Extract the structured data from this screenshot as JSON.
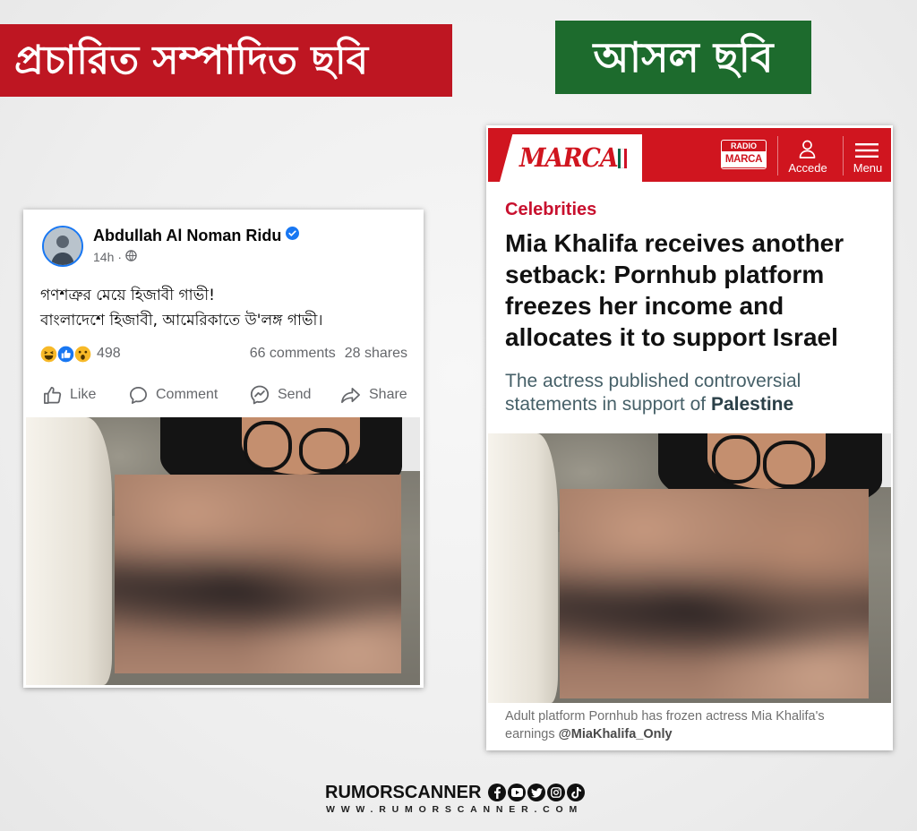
{
  "colors": {
    "edited_banner": "#be1622",
    "original_banner": "#1d6b2d",
    "marca_red": "#d0151f",
    "facebook_blue": "#1877f2",
    "category_red": "#c8102e",
    "background": "#efefef"
  },
  "banners": {
    "edited": {
      "label": "প্রচারিত সম্পাদিত ছবি"
    },
    "original": {
      "label": "আসল ছবি"
    }
  },
  "facebook_post": {
    "author": "Abdullah Al Noman Ridu",
    "verified_icon": "verified-badge-icon",
    "time": "14h",
    "time_separator": "·",
    "audience_icon": "globe-icon",
    "text_lines": [
      "গণশত্রুর মেয়ে হিজাবী গাভী!",
      "বাংলাদেশে হিজাবী, আমেরিকাতে উ'লঙ্গ গাভী।"
    ],
    "reaction_icons": [
      "haha-icon",
      "like-icon",
      "wow-icon"
    ],
    "reaction_count": "498",
    "comments": "66 comments",
    "shares": "28 shares",
    "actions": [
      {
        "label": "Like",
        "icon": "thumbs-up-icon"
      },
      {
        "label": "Comment",
        "icon": "comment-icon"
      },
      {
        "label": "Send",
        "icon": "messenger-icon"
      },
      {
        "label": "Share",
        "icon": "share-icon"
      }
    ]
  },
  "marca_article": {
    "logo": "MARCA",
    "logo_icon": "flag-icon",
    "radio_badge": {
      "top": "RADIO",
      "bottom": "MARCA"
    },
    "account_icon": "user-icon",
    "account_label": "Accede",
    "menu_icon": "hamburger-icon",
    "menu_label": "Menu",
    "category": "Celebrities",
    "headline_lines": [
      "Mia Khalifa receives another",
      "setback: Pornhub platform",
      "freezes her income and",
      "allocates it to support Israel"
    ],
    "subtitle_lines": [
      "The actress published controversial",
      "statements in support of "
    ],
    "subtitle_emphasis": "Palestine",
    "caption_lines": [
      "Adult platform Pornhub has frozen actress Mia Khalifa's",
      "earnings "
    ],
    "caption_handle": "@MiaKhalifa_Only"
  },
  "footer": {
    "brand": "RUMORSCANNER",
    "social_icons": [
      "facebook-icon",
      "youtube-icon",
      "twitter-icon",
      "instagram-icon",
      "tiktok-icon"
    ],
    "url": "WWW.RUMORSCANNER.COM"
  }
}
